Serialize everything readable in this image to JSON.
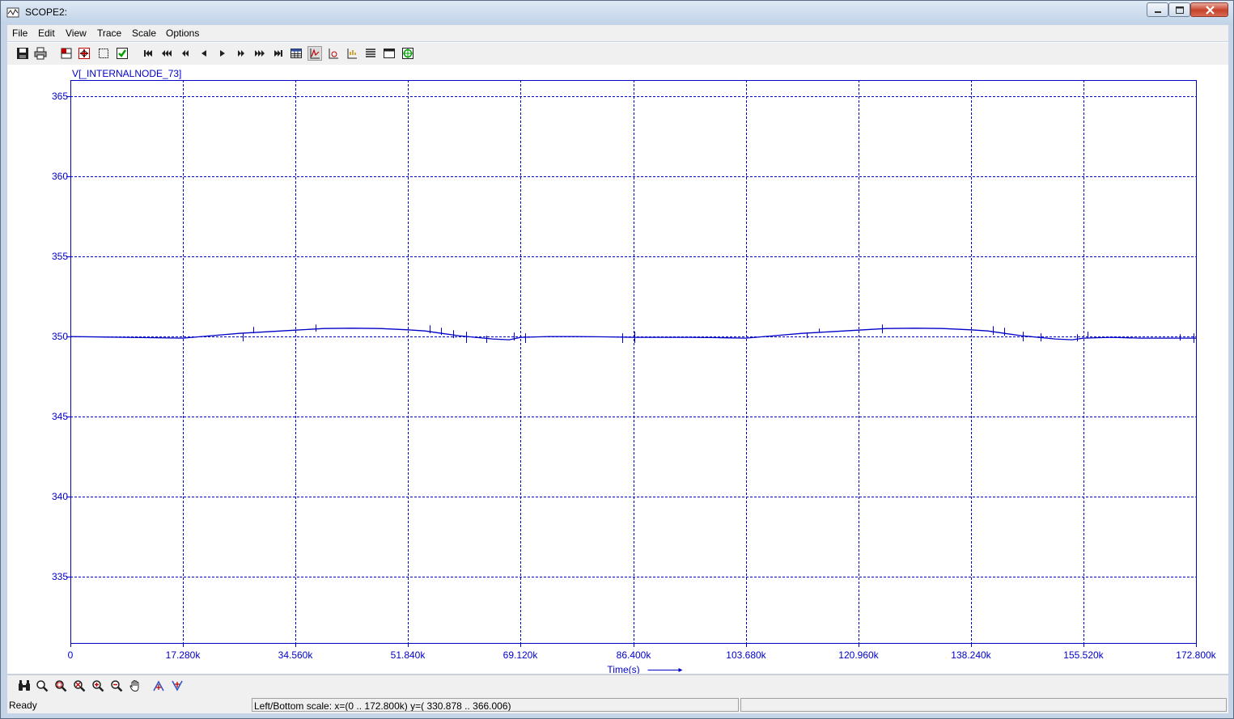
{
  "window": {
    "title": "SCOPE2:"
  },
  "menu": [
    "File",
    "Edit",
    "View",
    "Trace",
    "Scale",
    "Options"
  ],
  "toolbar": {
    "icons": [
      "save-icon",
      "print-icon",
      "layout-icon",
      "fit-icon",
      "select-icon",
      "check-icon",
      "first-icon",
      "fast-back-icon",
      "back-icon",
      "step-back-icon",
      "step-forward-icon",
      "forward-icon",
      "fast-forward-icon",
      "last-icon",
      "table-icon",
      "trace-icon",
      "cursor-icon",
      "axis-icon",
      "list-icon",
      "window-icon",
      "target-icon"
    ]
  },
  "bottom_toolbar": {
    "icons": [
      "binoculars-icon",
      "zoom-icon",
      "zoom-area-icon",
      "zoom-x-icon",
      "zoom-in-icon",
      "zoom-out-icon",
      "pan-hand-icon",
      "peak-up-icon",
      "peak-down-icon"
    ]
  },
  "status": {
    "ready": "Ready",
    "scale": "Left/Bottom scale:  x=(0 ..  172.800k) y=( 330.878 ..  366.006)",
    "extra": ""
  },
  "chart_data": {
    "type": "line",
    "title": "V[_INTERNALNODE_73]",
    "xlabel": "Time(s)",
    "ylabel": "",
    "xlim": [
      0,
      172800
    ],
    "ylim": [
      330.878,
      366.006
    ],
    "grid": true,
    "x_ticks": [
      0,
      17280,
      34560,
      51840,
      69120,
      86400,
      103680,
      120960,
      138240,
      155520,
      172800
    ],
    "x_tick_labels": [
      "0",
      "17.280k",
      "34.560k",
      "51.840k",
      "69.120k",
      "86.400k",
      "103.680k",
      "120.960k",
      "138.240k",
      "155.520k",
      "172.800k"
    ],
    "y_ticks": [
      335,
      340,
      345,
      350,
      355,
      360,
      365
    ],
    "y_tick_labels": [
      "335",
      "340",
      "345",
      "350",
      "355",
      "360",
      "365"
    ],
    "color": "#0000c8",
    "series": [
      {
        "name": "",
        "x": [
          0,
          8640,
          17280,
          21600,
          25920,
          30240,
          34560,
          38880,
          43200,
          47520,
          51840,
          54432,
          57024,
          59616,
          62208,
          64800,
          67392,
          69120,
          73440,
          77760,
          82080,
          86400,
          90720,
          95040,
          99360,
          103680,
          108000,
          112320,
          116640,
          120960,
          125280,
          129600,
          133920,
          138240,
          140832,
          143424,
          146016,
          148608,
          151200,
          153792,
          155520,
          159840,
          164160,
          168480,
          172800
        ],
        "y": [
          350.0,
          349.95,
          349.9,
          350.05,
          350.2,
          350.3,
          350.4,
          350.5,
          350.52,
          350.5,
          350.42,
          350.35,
          350.2,
          350.05,
          349.95,
          349.85,
          349.8,
          349.95,
          350.0,
          350.0,
          349.98,
          349.95,
          349.95,
          349.95,
          349.93,
          349.9,
          350.05,
          350.2,
          350.3,
          350.4,
          350.5,
          350.52,
          350.5,
          350.42,
          350.35,
          350.2,
          350.05,
          349.95,
          349.85,
          349.8,
          349.9,
          349.95,
          349.9,
          349.9,
          349.9
        ]
      }
    ],
    "spikes": [
      {
        "x": 26400,
        "y0": 349.7,
        "y1": 350.2
      },
      {
        "x": 28100,
        "y0": 350.2,
        "y1": 350.6
      },
      {
        "x": 37600,
        "y0": 350.3,
        "y1": 350.75
      },
      {
        "x": 55200,
        "y0": 350.2,
        "y1": 350.7
      },
      {
        "x": 56900,
        "y0": 350.1,
        "y1": 350.55
      },
      {
        "x": 58800,
        "y0": 349.9,
        "y1": 350.4
      },
      {
        "x": 60700,
        "y0": 349.6,
        "y1": 350.3
      },
      {
        "x": 63900,
        "y0": 349.6,
        "y1": 350.05
      },
      {
        "x": 68100,
        "y0": 349.75,
        "y1": 350.25
      },
      {
        "x": 69800,
        "y0": 349.6,
        "y1": 350.2
      },
      {
        "x": 84700,
        "y0": 349.6,
        "y1": 350.2
      },
      {
        "x": 86600,
        "y0": 349.6,
        "y1": 350.3
      },
      {
        "x": 113100,
        "y0": 349.9,
        "y1": 350.25
      },
      {
        "x": 114900,
        "y0": 350.25,
        "y1": 350.5
      },
      {
        "x": 124600,
        "y0": 350.2,
        "y1": 350.75
      },
      {
        "x": 141600,
        "y0": 350.1,
        "y1": 350.65
      },
      {
        "x": 143400,
        "y0": 350.05,
        "y1": 350.55
      },
      {
        "x": 146200,
        "y0": 349.7,
        "y1": 350.3
      },
      {
        "x": 149000,
        "y0": 349.7,
        "y1": 350.2
      },
      {
        "x": 154600,
        "y0": 349.7,
        "y1": 350.15
      },
      {
        "x": 156200,
        "y0": 349.9,
        "y1": 350.3
      },
      {
        "x": 170300,
        "y0": 349.75,
        "y1": 350.15
      },
      {
        "x": 172400,
        "y0": 349.6,
        "y1": 350.2
      }
    ]
  }
}
